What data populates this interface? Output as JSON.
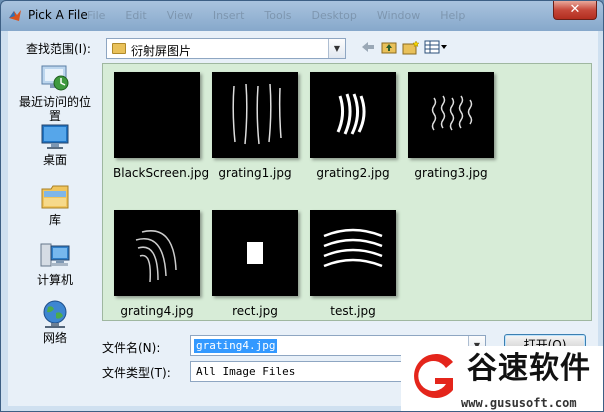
{
  "window": {
    "title": "Pick A File",
    "close_glyph": "✕",
    "ghost_menu": [
      "File",
      "Edit",
      "View",
      "Insert",
      "Tools",
      "Desktop",
      "Window",
      "Help"
    ]
  },
  "lookin": {
    "label": "查找范围(I):",
    "value": "衍射屏图片"
  },
  "toolbar": {
    "back_icon": "back-arrow-icon",
    "up_icon": "folder-up-icon",
    "new_folder_icon": "new-folder-icon",
    "view_icon": "view-menu-icon"
  },
  "places": [
    {
      "label": "最近访问的位置",
      "icon": "recent-places-icon"
    },
    {
      "label": "桌面",
      "icon": "desktop-icon"
    },
    {
      "label": "库",
      "icon": "libraries-icon"
    },
    {
      "label": "计算机",
      "icon": "computer-icon"
    },
    {
      "label": "网络",
      "icon": "network-icon"
    }
  ],
  "files": [
    {
      "name": "BlackScreen.jpg",
      "preview": "black"
    },
    {
      "name": "grating1.jpg",
      "preview": "vertical-lines"
    },
    {
      "name": "grating2.jpg",
      "preview": "curved-lines"
    },
    {
      "name": "grating3.jpg",
      "preview": "wavy-lines"
    },
    {
      "name": "grating4.jpg",
      "preview": "arcs"
    },
    {
      "name": "rect.jpg",
      "preview": "white-rect"
    },
    {
      "name": "test.jpg",
      "preview": "horizontal-arcs"
    }
  ],
  "filename": {
    "label": "文件名(N):",
    "value": "grating4.jpg"
  },
  "filetype": {
    "label": "文件类型(T):",
    "value": "All Image Files"
  },
  "buttons": {
    "open": "打开(O)"
  },
  "watermark": {
    "brand": "谷速软件",
    "url": "www.gususoft.com"
  },
  "colors": {
    "file_pane_bg": "#d7ecd7",
    "selection": "#3399ff",
    "close_button": "#c6483a"
  }
}
